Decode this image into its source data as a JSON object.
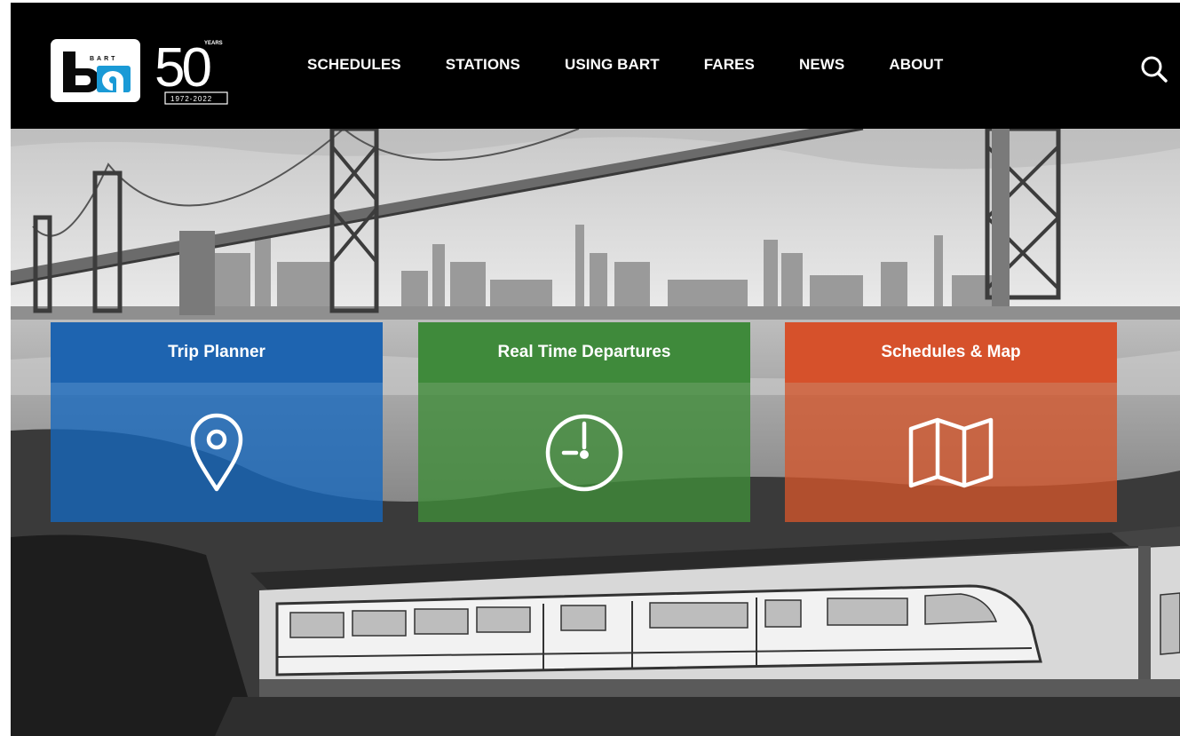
{
  "header": {
    "logo_text": "ba",
    "logo_small_text": "BART",
    "anniversary": {
      "number": "50",
      "label": "YEARS",
      "years": "1972-2022"
    },
    "nav": [
      {
        "label": "SCHEDULES"
      },
      {
        "label": "STATIONS"
      },
      {
        "label": "USING BART"
      },
      {
        "label": "FARES"
      },
      {
        "label": "NEWS"
      },
      {
        "label": "ABOUT"
      }
    ],
    "search_icon": "search-icon"
  },
  "tiles": [
    {
      "label": "Trip Planner",
      "icon": "map-pin-icon",
      "color": "#1e64b0"
    },
    {
      "label": "Real Time Departures",
      "icon": "clock-icon",
      "color": "#3f8a3b"
    },
    {
      "label": "Schedules & Map",
      "icon": "folded-map-icon",
      "color": "#d6512b"
    }
  ],
  "colors": {
    "header_bg": "#000000",
    "nav_text": "#ffffff",
    "logo_blue": "#1a9ad6"
  }
}
